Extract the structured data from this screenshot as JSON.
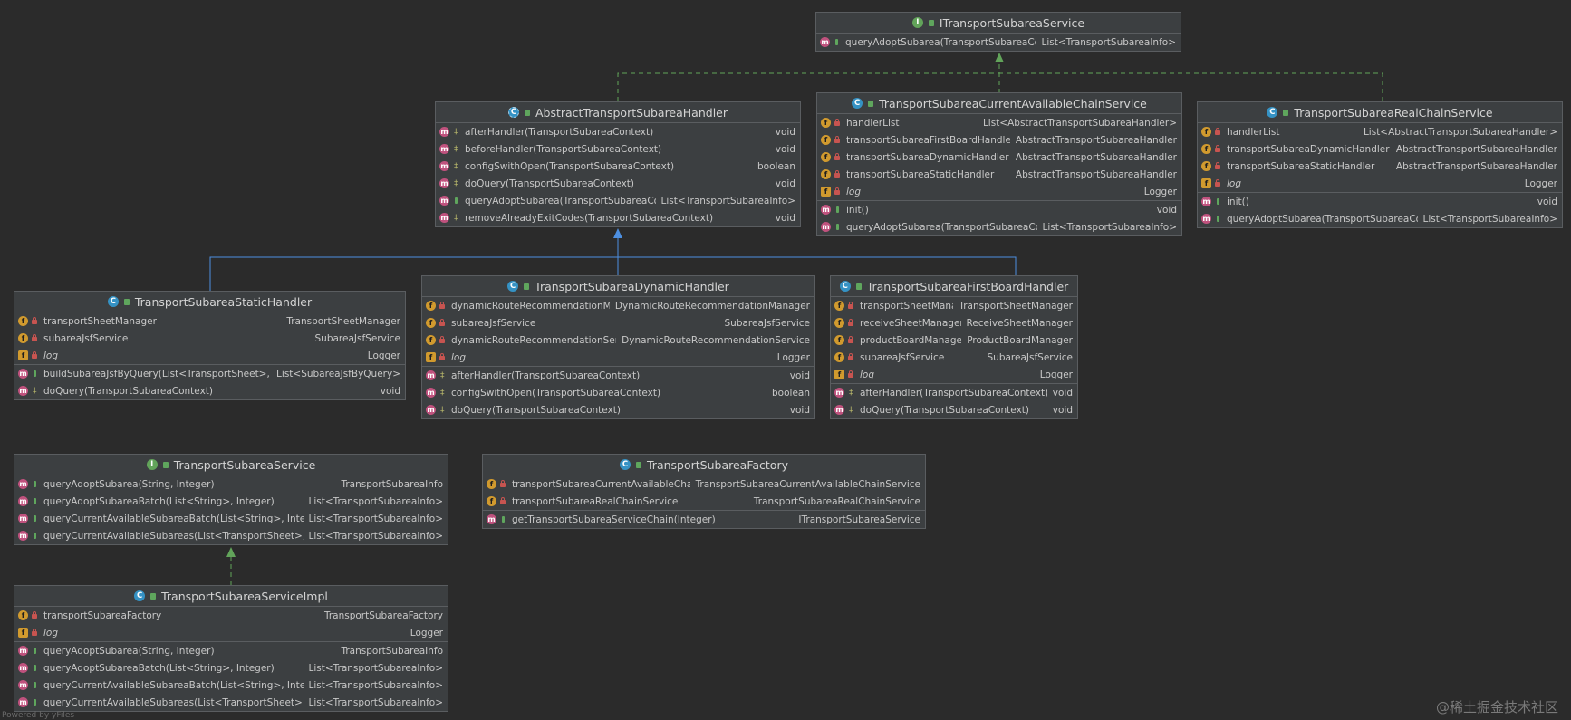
{
  "classes": {
    "itransport_service": {
      "title": "ITransportSubareaService",
      "kind": "I",
      "sections": [
        [
          {
            "icon": "m",
            "vis": "public",
            "name": "queryAdoptSubarea(TransportSubareaContext)",
            "type": "List<TransportSubareaInfo>"
          }
        ]
      ]
    },
    "abstract_handler": {
      "title": "AbstractTransportSubareaHandler",
      "kind": "A",
      "sections": [
        [
          {
            "icon": "m",
            "vis": "protected",
            "name": "afterHandler(TransportSubareaContext)",
            "type": "void"
          },
          {
            "icon": "m",
            "vis": "protected",
            "name": "beforeHandler(TransportSubareaContext)",
            "type": "void"
          },
          {
            "icon": "m",
            "vis": "protected",
            "name": "configSwithOpen(TransportSubareaContext)",
            "type": "boolean"
          },
          {
            "icon": "m",
            "vis": "protected",
            "name": "doQuery(TransportSubareaContext)",
            "type": "void"
          },
          {
            "icon": "m",
            "vis": "public",
            "name": "queryAdoptSubarea(TransportSubareaContext)",
            "type": "List<TransportSubareaInfo>"
          },
          {
            "icon": "m",
            "vis": "protected",
            "name": "removeAlreadyExitCodes(TransportSubareaContext)",
            "type": "void"
          }
        ]
      ]
    },
    "current_chain": {
      "title": "TransportSubareaCurrentAvailableChainService",
      "kind": "C",
      "sections": [
        [
          {
            "icon": "f",
            "vis": "private",
            "name": "handlerList",
            "type": "List<AbstractTransportSubareaHandler>"
          },
          {
            "icon": "f",
            "vis": "private",
            "name": "transportSubareaFirstBoardHandler",
            "type": "AbstractTransportSubareaHandler"
          },
          {
            "icon": "f",
            "vis": "private",
            "name": "transportSubareaDynamicHandler",
            "type": "AbstractTransportSubareaHandler"
          },
          {
            "icon": "f",
            "vis": "private",
            "name": "transportSubareaStaticHandler",
            "type": "AbstractTransportSubareaHandler"
          },
          {
            "icon": "log",
            "vis": "private",
            "name": "log",
            "type": "Logger",
            "italic": true
          }
        ],
        [
          {
            "icon": "m",
            "vis": "public",
            "name": "init()",
            "type": "void"
          },
          {
            "icon": "m",
            "vis": "public",
            "name": "queryAdoptSubarea(TransportSubareaContext)",
            "type": "List<TransportSubareaInfo>"
          }
        ]
      ]
    },
    "real_chain": {
      "title": "TransportSubareaRealChainService",
      "kind": "C",
      "sections": [
        [
          {
            "icon": "f",
            "vis": "private",
            "name": "handlerList",
            "type": "List<AbstractTransportSubareaHandler>"
          },
          {
            "icon": "f",
            "vis": "private",
            "name": "transportSubareaDynamicHandler",
            "type": "AbstractTransportSubareaHandler"
          },
          {
            "icon": "f",
            "vis": "private",
            "name": "transportSubareaStaticHandler",
            "type": "AbstractTransportSubareaHandler"
          },
          {
            "icon": "log",
            "vis": "private",
            "name": "log",
            "type": "Logger",
            "italic": true
          }
        ],
        [
          {
            "icon": "m",
            "vis": "public",
            "name": "init()",
            "type": "void"
          },
          {
            "icon": "m",
            "vis": "public",
            "name": "queryAdoptSubarea(TransportSubareaContext)",
            "type": "List<TransportSubareaInfo>"
          }
        ]
      ]
    },
    "static_handler": {
      "title": "TransportSubareaStaticHandler",
      "kind": "C",
      "sections": [
        [
          {
            "icon": "f",
            "vis": "private",
            "name": "transportSheetManager",
            "type": "TransportSheetManager"
          },
          {
            "icon": "f",
            "vis": "private",
            "name": "subareaJsfService",
            "type": "SubareaJsfService"
          },
          {
            "icon": "log",
            "vis": "private",
            "name": "log",
            "type": "Logger",
            "italic": true
          }
        ],
        [
          {
            "icon": "m",
            "vis": "public",
            "name": "buildSubareaJsfByQuery(List<TransportSheet>, Integer)",
            "type": "List<SubareaJsfByQuery>"
          },
          {
            "icon": "m",
            "vis": "protected",
            "name": "doQuery(TransportSubareaContext)",
            "type": "void"
          }
        ]
      ]
    },
    "dynamic_handler": {
      "title": "TransportSubareaDynamicHandler",
      "kind": "C",
      "sections": [
        [
          {
            "icon": "f",
            "vis": "private",
            "name": "dynamicRouteRecommendationManager",
            "type": "DynamicRouteRecommendationManager"
          },
          {
            "icon": "f",
            "vis": "private",
            "name": "subareaJsfService",
            "type": "SubareaJsfService"
          },
          {
            "icon": "f",
            "vis": "private",
            "name": "dynamicRouteRecommendationService",
            "type": "DynamicRouteRecommendationService"
          },
          {
            "icon": "log",
            "vis": "private",
            "name": "log",
            "type": "Logger",
            "italic": true
          }
        ],
        [
          {
            "icon": "m",
            "vis": "protected",
            "name": "afterHandler(TransportSubareaContext)",
            "type": "void"
          },
          {
            "icon": "m",
            "vis": "protected",
            "name": "configSwithOpen(TransportSubareaContext)",
            "type": "boolean"
          },
          {
            "icon": "m",
            "vis": "protected",
            "name": "doQuery(TransportSubareaContext)",
            "type": "void"
          }
        ]
      ]
    },
    "firstboard_handler": {
      "title": "TransportSubareaFirstBoardHandler",
      "kind": "C",
      "sections": [
        [
          {
            "icon": "f",
            "vis": "private",
            "name": "transportSheetManager",
            "type": "TransportSheetManager"
          },
          {
            "icon": "f",
            "vis": "private",
            "name": "receiveSheetManager",
            "type": "ReceiveSheetManager"
          },
          {
            "icon": "f",
            "vis": "private",
            "name": "productBoardManager",
            "type": "ProductBoardManager"
          },
          {
            "icon": "f",
            "vis": "private",
            "name": "subareaJsfService",
            "type": "SubareaJsfService"
          },
          {
            "icon": "log",
            "vis": "private",
            "name": "log",
            "type": "Logger",
            "italic": true
          }
        ],
        [
          {
            "icon": "m",
            "vis": "protected",
            "name": "afterHandler(TransportSubareaContext)",
            "type": "void"
          },
          {
            "icon": "m",
            "vis": "protected",
            "name": "doQuery(TransportSubareaContext)",
            "type": "void"
          }
        ]
      ]
    },
    "subarea_service": {
      "title": "TransportSubareaService",
      "kind": "I",
      "sections": [
        [
          {
            "icon": "m",
            "vis": "public",
            "name": "queryAdoptSubarea(String, Integer)",
            "type": "TransportSubareaInfo"
          },
          {
            "icon": "m",
            "vis": "public",
            "name": "queryAdoptSubareaBatch(List<String>, Integer)",
            "type": "List<TransportSubareaInfo>"
          },
          {
            "icon": "m",
            "vis": "public",
            "name": "queryCurrentAvailableSubareaBatch(List<String>, Integer)",
            "type": "List<TransportSubareaInfo>"
          },
          {
            "icon": "m",
            "vis": "public",
            "name": "queryCurrentAvailableSubareas(List<TransportSheet>, Integer)",
            "type": "List<TransportSubareaInfo>"
          }
        ]
      ]
    },
    "subarea_factory": {
      "title": "TransportSubareaFactory",
      "kind": "C",
      "sections": [
        [
          {
            "icon": "f",
            "vis": "private",
            "name": "transportSubareaCurrentAvailableChainService",
            "type": "TransportSubareaCurrentAvailableChainService"
          },
          {
            "icon": "f",
            "vis": "private",
            "name": "transportSubareaRealChainService",
            "type": "TransportSubareaRealChainService"
          }
        ],
        [
          {
            "icon": "m",
            "vis": "public",
            "name": "getTransportSubareaServiceChain(Integer)",
            "type": "ITransportSubareaService"
          }
        ]
      ]
    },
    "service_impl": {
      "title": "TransportSubareaServiceImpl",
      "kind": "C",
      "sections": [
        [
          {
            "icon": "f",
            "vis": "private",
            "name": "transportSubareaFactory",
            "type": "TransportSubareaFactory"
          },
          {
            "icon": "log",
            "vis": "private",
            "name": "log",
            "type": "Logger",
            "italic": true
          }
        ],
        [
          {
            "icon": "m",
            "vis": "public",
            "name": "queryAdoptSubarea(String, Integer)",
            "type": "TransportSubareaInfo"
          },
          {
            "icon": "m",
            "vis": "public",
            "name": "queryAdoptSubareaBatch(List<String>, Integer)",
            "type": "List<TransportSubareaInfo>"
          },
          {
            "icon": "m",
            "vis": "public",
            "name": "queryCurrentAvailableSubareaBatch(List<String>, Integer)",
            "type": "List<TransportSubareaInfo>"
          },
          {
            "icon": "m",
            "vis": "public",
            "name": "queryCurrentAvailableSubareas(List<TransportSheet>, Integer)",
            "type": "List<TransportSubareaInfo>"
          }
        ]
      ]
    }
  },
  "colors": {
    "background": "#2b2b2b",
    "box": "#3c3f41",
    "border": "#5a5d60",
    "implements": "#62a45a",
    "extends": "#4d8fe0"
  },
  "footer": {
    "watermark": "@稀土掘金技术社区",
    "powered": "Powered by yFiles"
  }
}
